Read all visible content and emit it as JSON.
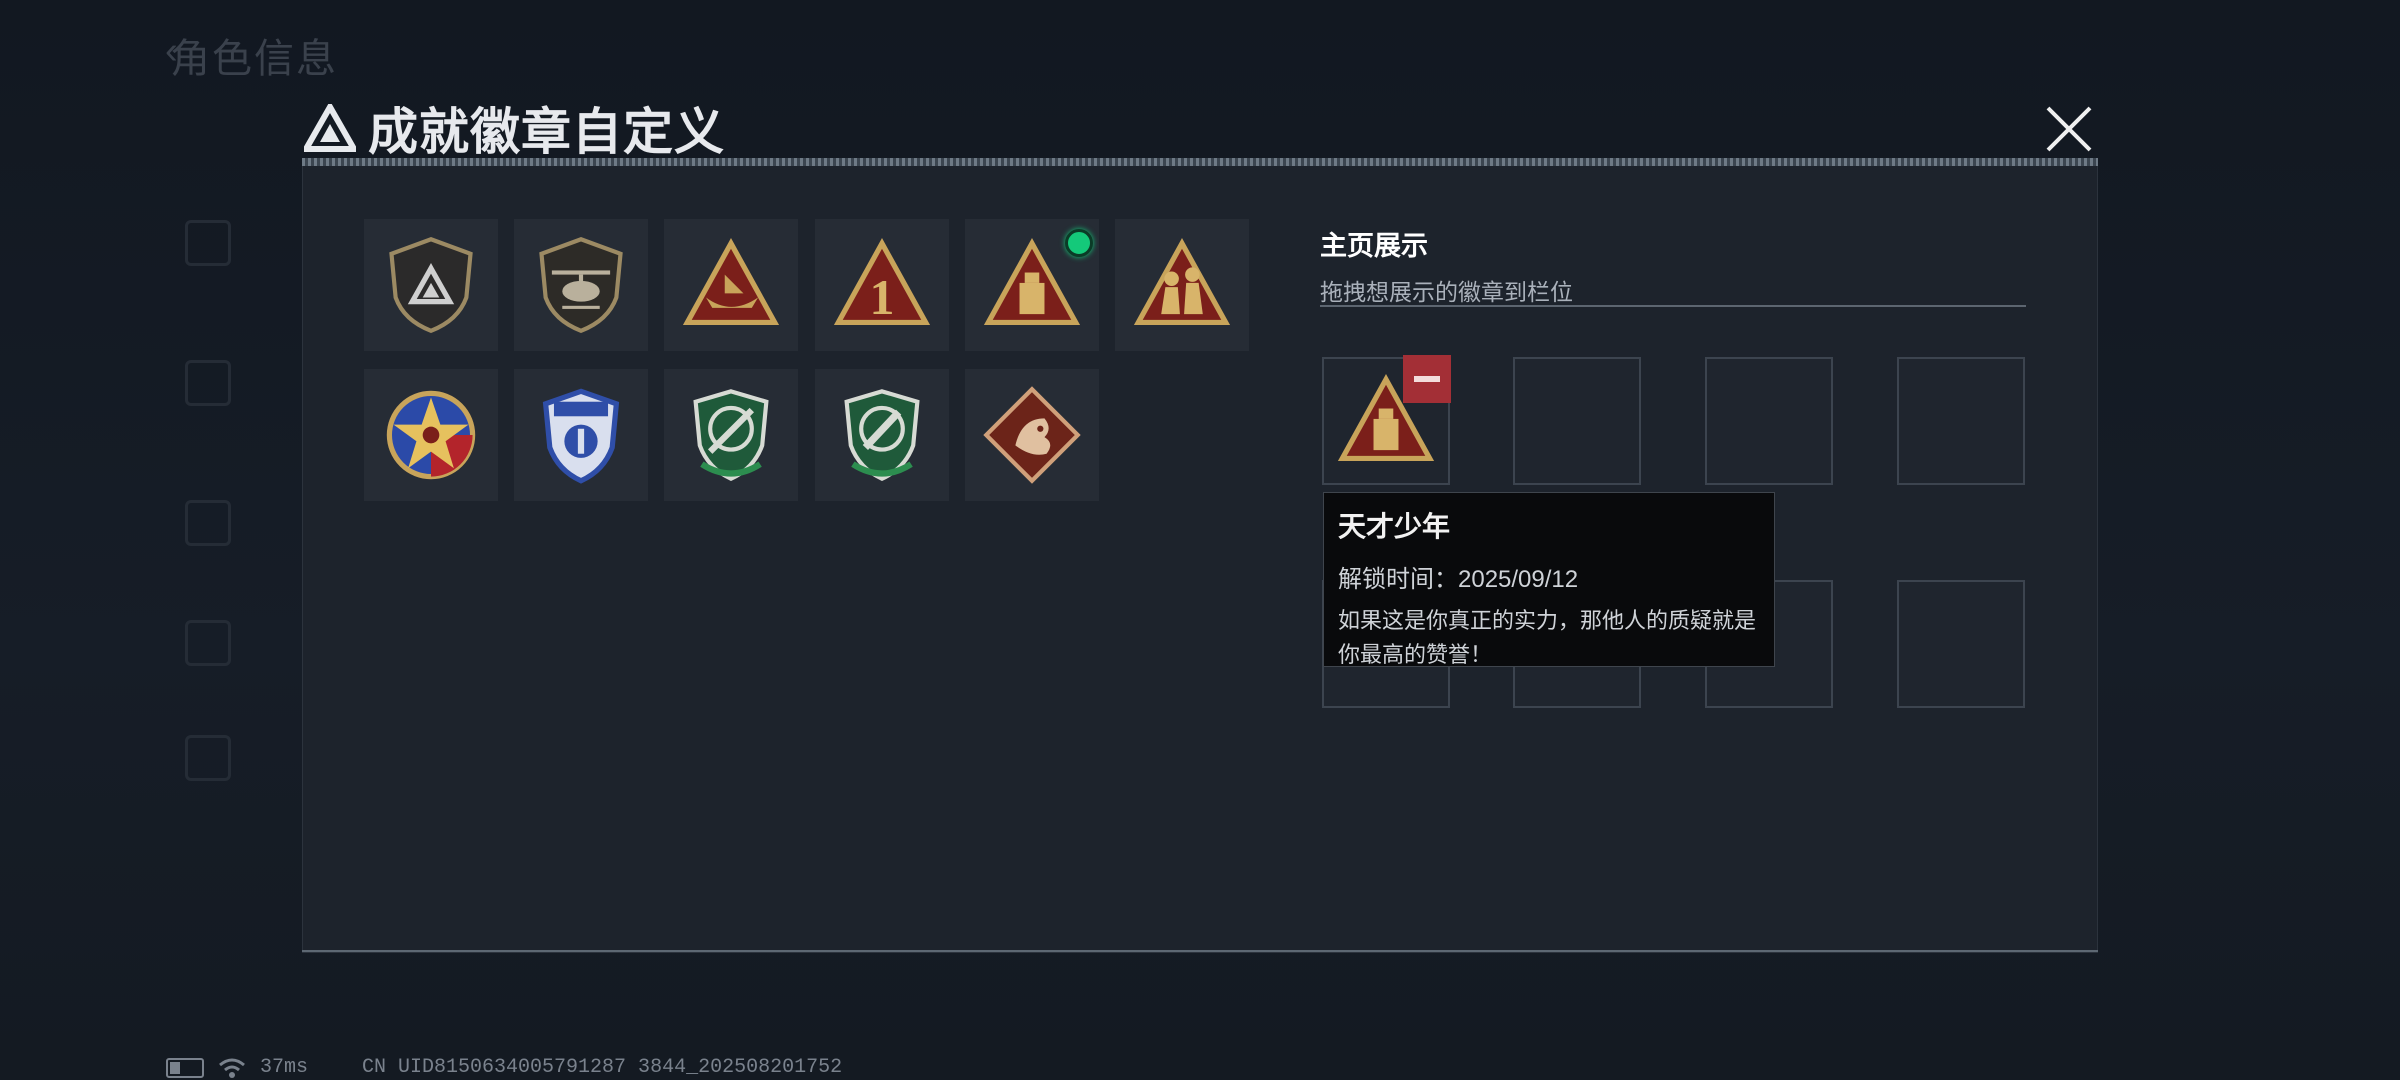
{
  "background": {
    "title": "角色信息"
  },
  "modal": {
    "title": "成就徽章自定义"
  },
  "badges": [
    {
      "icon": "shield-logo-badge-icon"
    },
    {
      "icon": "helicopter-badge-icon"
    },
    {
      "icon": "boat-badge-icon"
    },
    {
      "icon": "number-one-badge-icon"
    },
    {
      "icon": "usb-drive-badge-icon",
      "new": true
    },
    {
      "icon": "soldiers-badge-icon"
    },
    {
      "icon": "star-medal-badge-icon"
    },
    {
      "icon": "police-shield-badge-icon"
    },
    {
      "icon": "green-shield-knife-badge-icon"
    },
    {
      "icon": "green-shield-dagger-badge-icon"
    },
    {
      "icon": "dragon-badge-icon"
    }
  ],
  "display": {
    "heading": "主页展示",
    "subheading": "拖拽想展示的徽章到栏位",
    "slot1_badge": "usb-drive-badge-icon"
  },
  "tooltip": {
    "name": "天才少年",
    "unlock": "解锁时间：2025/09/12",
    "desc": "如果这是你真正的实力，那他人的质疑就是你最高的赞誉！"
  },
  "status": {
    "ping": "37ms",
    "uid": "CN UID8150634005791287 3844_202508201752"
  },
  "colors": {
    "accent_green": "#14c97a",
    "remove_red": "#a32f36",
    "gold": "#c8a45a"
  }
}
